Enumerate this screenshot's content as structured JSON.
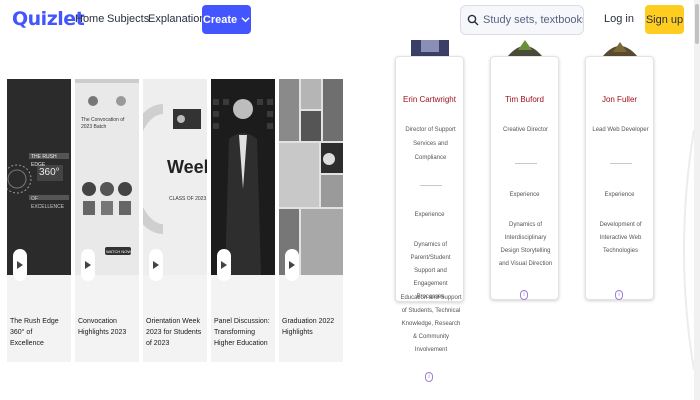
{
  "header": {
    "logo": "Quizlet",
    "nav": [
      "Home",
      "Subjects",
      "Explanations"
    ],
    "create_label": "Create",
    "search_placeholder": "Study sets, textbooks, ...",
    "login_label": "Log in",
    "signup_label": "Sign up"
  },
  "colors": {
    "brand": "#4255ff",
    "signup": "#ffcd1f",
    "name_red": "#a01020",
    "accent_purple": "#9b7fd8"
  },
  "videos": [
    {
      "title": "The Rush Edge 360° of Excellence",
      "thumb_text_1": "THE RUSH EDGE",
      "thumb_text_2": "360°",
      "thumb_text_3": "OF EXCELLENCE"
    },
    {
      "title": "Convocation Highlights 2023",
      "thumb_text_1": "The Convocation of 2023 Batch",
      "thumb_text_2": "WATCH NOW"
    },
    {
      "title": "Orientation Week 2023 for Students of 2023",
      "thumb_text_1": "Week",
      "thumb_text_2": "CLASS OF 2023"
    },
    {
      "title": "Panel Discussion: Transforming Higher Education",
      "thumb_text_1": ""
    },
    {
      "title": "Graduation 2022 Highlights",
      "thumb_text_1": ""
    }
  ],
  "people": [
    {
      "name": "Erin Cartwright",
      "role": "Director of Support Services and Compliance",
      "sub": "Experience",
      "detail": "Dynamics of Parent/Student Support and Engagement Processes"
    },
    {
      "name": "Tim Buford",
      "role": "Creative Director",
      "sub": "Experience",
      "detail": "Dynamics of Interdisciplinary Design Storytelling and Visual Direction"
    },
    {
      "name": "Jon Fuller",
      "role": "Lead Web Developer",
      "sub": "Experience",
      "detail": "Development of Interactive Web Technologies"
    }
  ],
  "extra_text": "Education and Support of Students, Technical Knowledge, Research & Community Involvement"
}
